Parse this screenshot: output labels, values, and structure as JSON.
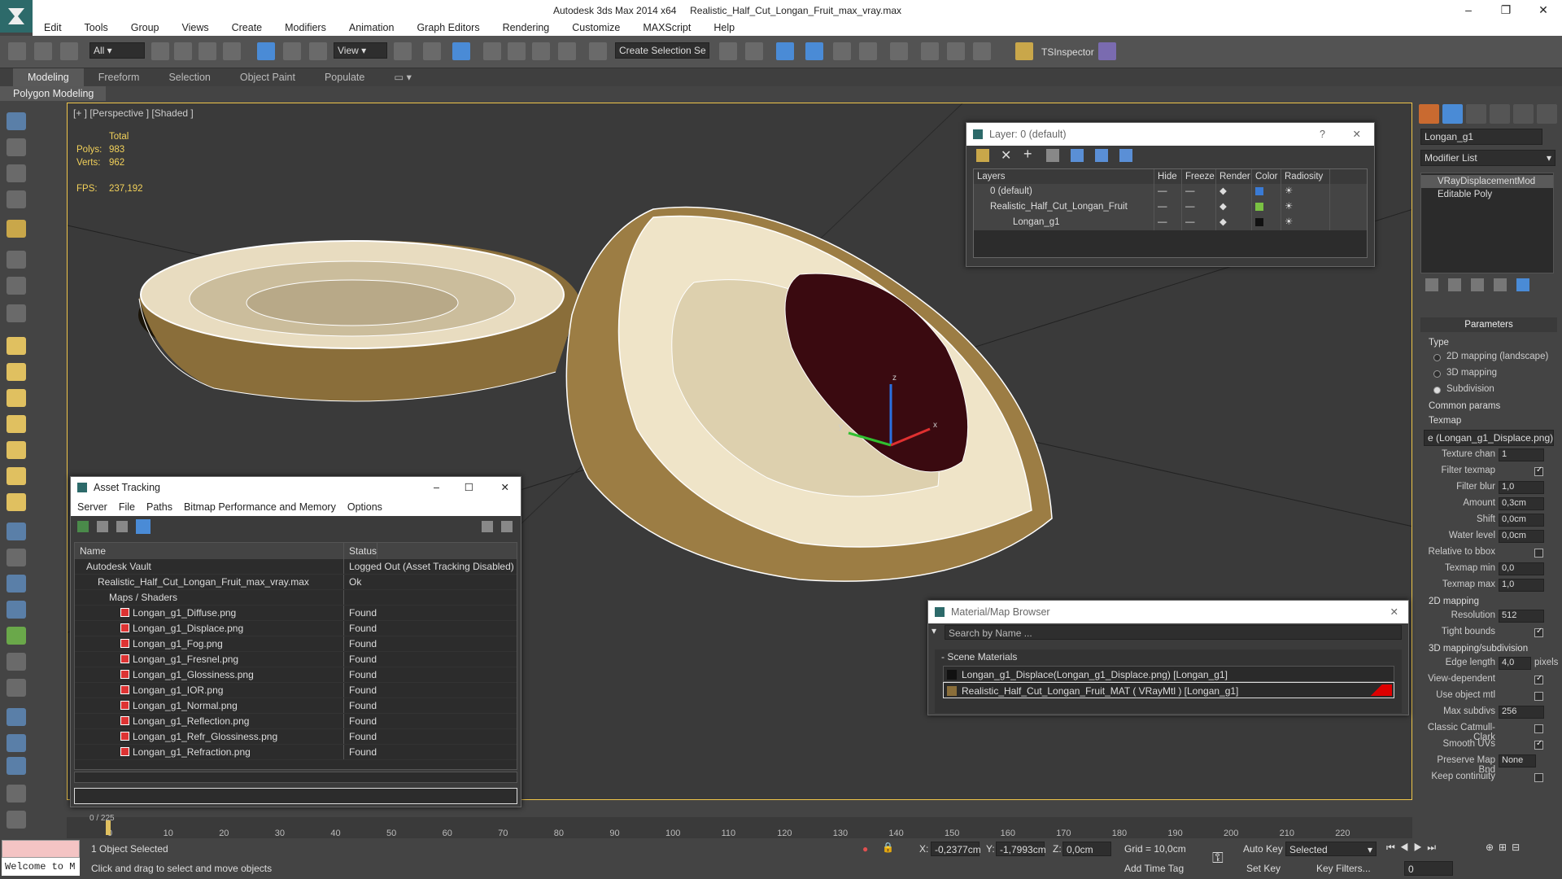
{
  "app": {
    "title": "Autodesk 3ds Max  2014 x64",
    "file": "Realistic_Half_Cut_Longan_Fruit_max_vray.max",
    "window_buttons": [
      "–",
      "❐",
      "✕"
    ]
  },
  "menu": [
    "Edit",
    "Tools",
    "Group",
    "Views",
    "Create",
    "Modifiers",
    "Animation",
    "Graph Editors",
    "Rendering",
    "Customize",
    "MAXScript",
    "Help"
  ],
  "toolbar": {
    "selection_filter": "All",
    "ref_coord": "View",
    "named_sel": "Create Selection Se",
    "tsinspector": "TSInspector"
  },
  "ribbon": {
    "tabs": [
      "Modeling",
      "Freeform",
      "Selection",
      "Object Paint",
      "Populate"
    ],
    "sub": "Polygon Modeling"
  },
  "viewport": {
    "label": "[+ ] [Perspective ] [Shaded ]",
    "stats": {
      "total_label": "Total",
      "polys_label": "Polys:",
      "polys": "983",
      "verts_label": "Verts:",
      "verts": "962",
      "fps_label": "FPS:",
      "fps": "237,192"
    },
    "gizmo_labels": {
      "x": "x",
      "y": "y",
      "z": "z"
    }
  },
  "layer_dialog": {
    "title": "Layer: 0 (default)",
    "help": "?",
    "close": "✕",
    "columns": [
      "Layers",
      "Hide",
      "Freeze",
      "Render",
      "Color",
      "Radiosity"
    ],
    "rows": [
      {
        "name": "0 (default)",
        "color": "#3a7bd5"
      },
      {
        "name": "Realistic_Half_Cut_Longan_Fruit",
        "color": "#7ac143"
      },
      {
        "name": "Longan_g1",
        "color": "#111111"
      }
    ]
  },
  "asset_tracking": {
    "title": "Asset Tracking",
    "menu": [
      "Server",
      "File",
      "Paths",
      "Bitmap Performance and Memory",
      "Options"
    ],
    "columns": [
      "Name",
      "Status"
    ],
    "rows": [
      {
        "name": "Autodesk Vault",
        "status": "Logged Out (Asset Tracking Disabled)",
        "indent": 1
      },
      {
        "name": "Realistic_Half_Cut_Longan_Fruit_max_vray.max",
        "status": "Ok",
        "indent": 2
      },
      {
        "name": "Maps / Shaders",
        "status": "",
        "indent": 3
      },
      {
        "name": "Longan_g1_Diffuse.png",
        "status": "Found",
        "indent": 4
      },
      {
        "name": "Longan_g1_Displace.png",
        "status": "Found",
        "indent": 4
      },
      {
        "name": "Longan_g1_Fog.png",
        "status": "Found",
        "indent": 4
      },
      {
        "name": "Longan_g1_Fresnel.png",
        "status": "Found",
        "indent": 4
      },
      {
        "name": "Longan_g1_Glossiness.png",
        "status": "Found",
        "indent": 4
      },
      {
        "name": "Longan_g1_IOR.png",
        "status": "Found",
        "indent": 4
      },
      {
        "name": "Longan_g1_Normal.png",
        "status": "Found",
        "indent": 4
      },
      {
        "name": "Longan_g1_Reflection.png",
        "status": "Found",
        "indent": 4
      },
      {
        "name": "Longan_g1_Refr_Glossiness.png",
        "status": "Found",
        "indent": 4
      },
      {
        "name": "Longan_g1_Refraction.png",
        "status": "Found",
        "indent": 4
      }
    ]
  },
  "material_browser": {
    "title": "Material/Map Browser",
    "search_placeholder": "Search by Name ...",
    "section": "- Scene Materials",
    "items": [
      "Longan_g1_Displace(Longan_g1_Displace.png) [Longan_g1]",
      "Realistic_Half_Cut_Longan_Fruit_MAT ( VRayMtl ) [Longan_g1]"
    ]
  },
  "command_panel": {
    "object_name": "Longan_g1",
    "modifier_list": "Modifier List",
    "stack": [
      "VRayDisplacementMod",
      "Editable Poly"
    ],
    "parameters_header": "Parameters",
    "type_label": "Type",
    "type_options": [
      "2D mapping (landscape)",
      "3D mapping",
      "Subdivision"
    ],
    "common_params": "Common params",
    "texmap_label": "Texmap",
    "texmap_value": "e (Longan_g1_Displace.png)",
    "fields": [
      {
        "label": "Texture chan",
        "value": "1"
      },
      {
        "label": "Filter texmap",
        "value": ""
      },
      {
        "label": "Filter blur",
        "value": "1,0"
      },
      {
        "label": "Amount",
        "value": "0,3cm"
      },
      {
        "label": "Shift",
        "value": "0,0cm"
      },
      {
        "label": "Water level",
        "value": "0,0cm"
      },
      {
        "label": "Relative to bbox",
        "value": ""
      },
      {
        "label": "Texmap min",
        "value": "0,0"
      },
      {
        "label": "Texmap max",
        "value": "1,0"
      }
    ],
    "mapping2d": "2D mapping",
    "resolution_label": "Resolution",
    "resolution": "512",
    "tight_bounds": "Tight bounds",
    "mapping3d": "3D mapping/subdivision",
    "edge_length_label": "Edge length",
    "edge_length": "4,0",
    "pixels": "pixels",
    "view_dependent": "View-dependent",
    "use_object_mtl": "Use object mtl",
    "max_subdivs_label": "Max subdivs",
    "max_subdivs": "256",
    "classic_catmull": "Classic Catmull-Clark",
    "smooth_uvs": "Smooth UVs",
    "preserve_map_bnd": "Preserve Map Bnd",
    "preserve_value": "None",
    "keep_continuity": "Keep continuity"
  },
  "timeline": {
    "frame_display": "0 / 225",
    "ticks": [
      "0",
      "10",
      "20",
      "30",
      "40",
      "50",
      "60",
      "70",
      "80",
      "90",
      "100",
      "110",
      "120",
      "130",
      "140",
      "150",
      "160",
      "170",
      "180",
      "190",
      "200",
      "210",
      "220"
    ]
  },
  "statusbar": {
    "welcome": "Welcome to M",
    "selected": "1 Object Selected",
    "hint": "Click and drag to select and move objects",
    "x_label": "X:",
    "x": "-0,2377cm",
    "y_label": "Y:",
    "y": "-1,7993cm",
    "z_label": "Z:",
    "z": "0,0cm",
    "grid": "Grid = 10,0cm",
    "add_time_tag": "Add Time Tag",
    "auto_key": "Auto Key",
    "set_key": "Set Key",
    "key_mode": "Selected",
    "key_filters": "Key Filters...",
    "frame": "0"
  },
  "colors": {
    "viewport_border": "#f0c64a",
    "accent": "#3b8fd6"
  }
}
